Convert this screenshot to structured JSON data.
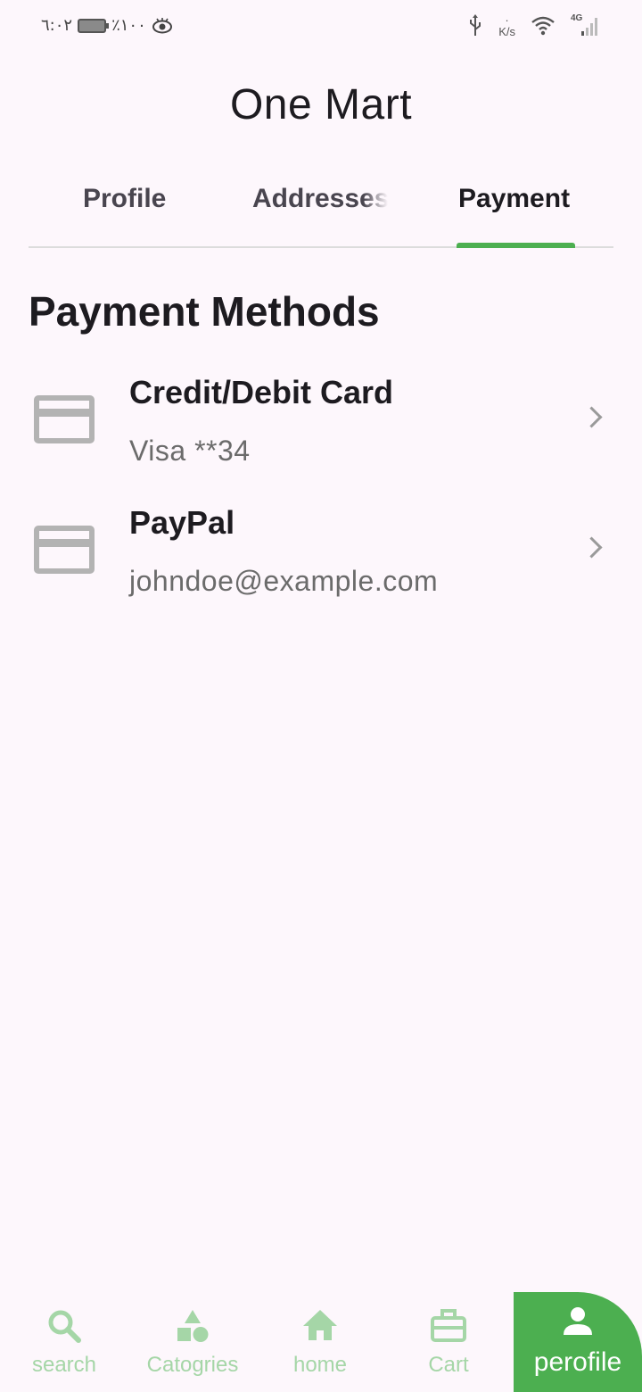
{
  "status_bar": {
    "time": "٦:٠٢",
    "battery": "٪١٠٠",
    "net_speed_value": "·",
    "net_speed_unit": "K/s",
    "network": "4G"
  },
  "app": {
    "title": "One Mart"
  },
  "tabs": [
    {
      "label": "Profile"
    },
    {
      "label": "Addresses"
    },
    {
      "label": "Payment"
    }
  ],
  "active_tab": "Payment",
  "section": {
    "title": "Payment Methods"
  },
  "payment_methods": [
    {
      "title": "Credit/Debit Card",
      "detail": "Visa **34",
      "icon": "credit-card-icon"
    },
    {
      "title": "PayPal",
      "detail": "johndoe@example.com",
      "icon": "credit-card-icon"
    }
  ],
  "bottom_nav": [
    {
      "label": "search",
      "icon": "search-icon"
    },
    {
      "label": "Catogries",
      "icon": "categories-icon"
    },
    {
      "label": "home",
      "icon": "home-icon"
    },
    {
      "label": "Cart",
      "icon": "cart-icon"
    },
    {
      "label": "perofile",
      "icon": "person-icon"
    }
  ],
  "colors": {
    "accent": "#4caf50",
    "nav_inactive": "#a5d6a7",
    "background": "#fdf7fc",
    "icon_gray": "#b3b3b3"
  }
}
